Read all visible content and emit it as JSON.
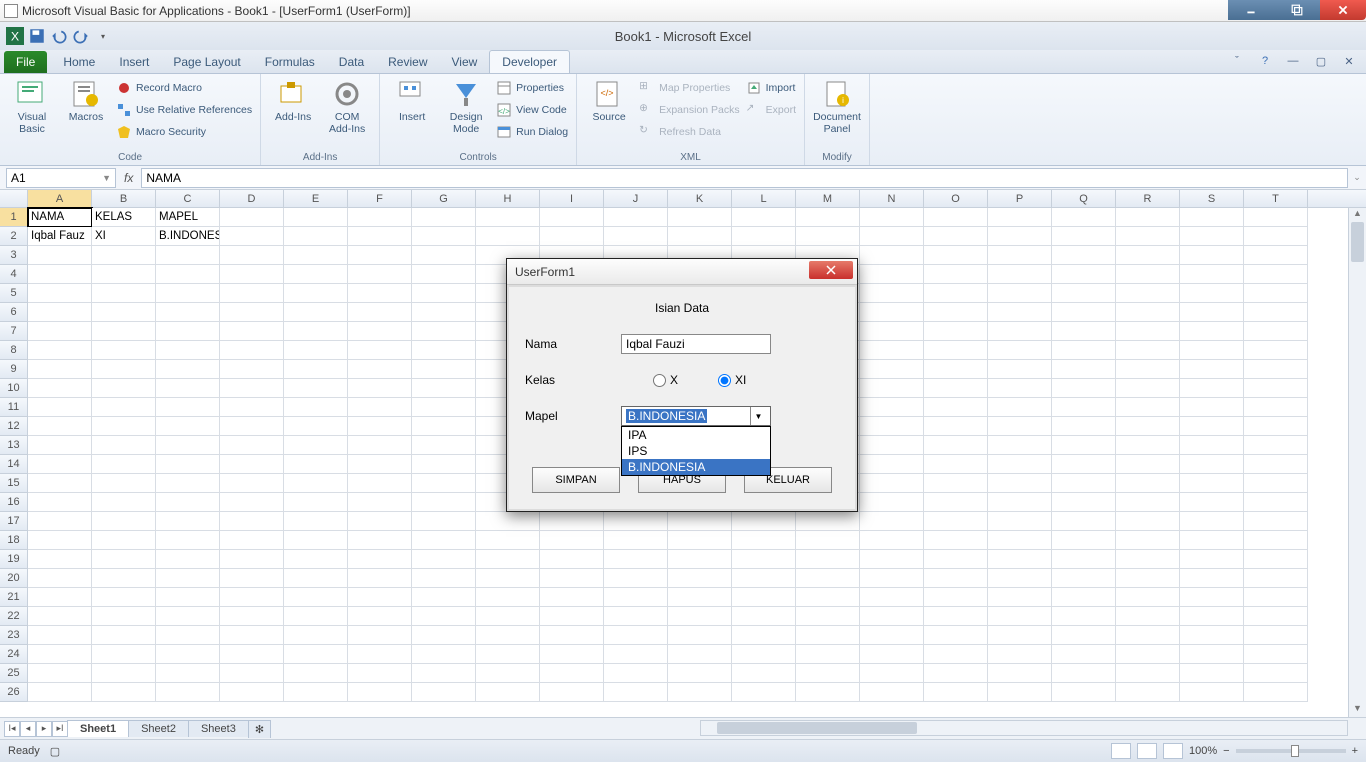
{
  "vba_title": "Microsoft Visual Basic for Applications - Book1 - [UserForm1 (UserForm)]",
  "excel_title": "Book1 - Microsoft Excel",
  "tabs": {
    "file": "File",
    "home": "Home",
    "insert": "Insert",
    "page_layout": "Page Layout",
    "formulas": "Formulas",
    "data": "Data",
    "review": "Review",
    "view": "View",
    "developer": "Developer"
  },
  "ribbon": {
    "code": {
      "visual_basic": "Visual\nBasic",
      "macros": "Macros",
      "record_macro": "Record Macro",
      "use_rel": "Use Relative References",
      "macro_sec": "Macro Security",
      "label": "Code"
    },
    "addins": {
      "addins": "Add-Ins",
      "com": "COM\nAdd-Ins",
      "label": "Add-Ins"
    },
    "controls": {
      "insert": "Insert",
      "design": "Design\nMode",
      "properties": "Properties",
      "view_code": "View Code",
      "run_dialog": "Run Dialog",
      "label": "Controls"
    },
    "xml": {
      "source": "Source",
      "map_props": "Map Properties",
      "expansion": "Expansion Packs",
      "refresh": "Refresh Data",
      "import": "Import",
      "export": "Export",
      "label": "XML"
    },
    "modify": {
      "doc_panel": "Document\nPanel",
      "label": "Modify"
    }
  },
  "namebox": "A1",
  "formula": "NAMA",
  "columns": [
    "A",
    "B",
    "C",
    "D",
    "E",
    "F",
    "G",
    "H",
    "I",
    "J",
    "K",
    "L",
    "M",
    "N",
    "O",
    "P",
    "Q",
    "R",
    "S",
    "T"
  ],
  "rows": [
    1,
    2,
    3,
    4,
    5,
    6,
    7,
    8,
    9,
    10,
    11,
    12,
    13,
    14,
    15,
    16,
    17,
    18,
    19,
    20,
    21,
    22,
    23,
    24,
    25,
    26
  ],
  "cells": {
    "r1": {
      "A": "NAMA",
      "B": "KELAS",
      "C": "MAPEL"
    },
    "r2": {
      "A": "Iqbal Fauz",
      "B": "XI",
      "C": "B.INDONESIA"
    }
  },
  "sheets": [
    "Sheet1",
    "Sheet2",
    "Sheet3"
  ],
  "status": "Ready",
  "zoom": "100%",
  "userform": {
    "title": "UserForm1",
    "heading": "Isian Data",
    "nama_label": "Nama",
    "nama_value": "Iqbal Fauzi",
    "kelas_label": "Kelas",
    "kelas_x": "X",
    "kelas_xi": "XI",
    "mapel_label": "Mapel",
    "mapel_value": "B.INDONESIA",
    "mapel_options": {
      "ipa": "IPA",
      "ips": "IPS",
      "bind": "B.INDONESIA"
    },
    "simpan": "SIMPAN",
    "hapus": "HAPUS",
    "keluar": "KELUAR"
  }
}
